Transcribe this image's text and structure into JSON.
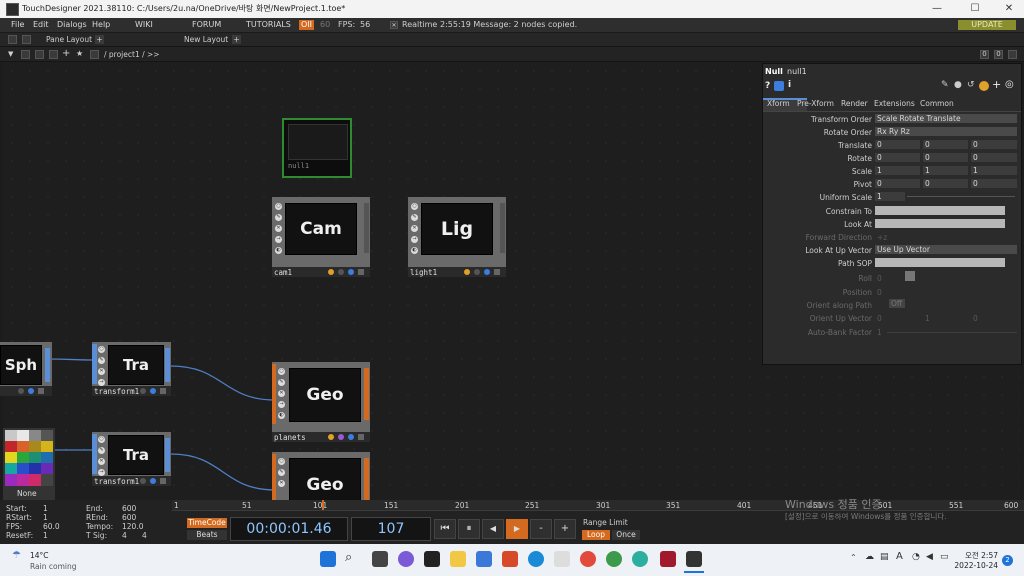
{
  "window": {
    "title": "TouchDesigner 2021.38110: C:/Users/2u.na/OneDrive/바탕 화면/NewProject.1.toe*"
  },
  "menu": {
    "items": [
      "File",
      "Edit",
      "Dialogs",
      "Help",
      "WIKI",
      "FORUM",
      "TUTORIALS"
    ],
    "oi": "OII",
    "fps_a": "60",
    "fps_label": "FPS:",
    "fps_value": "56",
    "realtime": "Realtime",
    "message": "2:55:19 Message: 2 nodes copied.",
    "update": "UPDATE"
  },
  "panebar": {
    "pane_layout": "Pane Layout",
    "new_layout": "New Layout",
    "plus": "+"
  },
  "pathbar": {
    "path": "/ project1 / >>",
    "right_a": "0",
    "right_b": "0"
  },
  "nodes": {
    "null_name": "null1",
    "cam_title": "Cam",
    "cam_name": "cam1",
    "light_title": "Lig",
    "light_name": "light1",
    "sph_title": "Sph",
    "tra1_title": "Tra",
    "tra1_name": "transform1",
    "geo1_title": "Geo",
    "geo1_name": "planets",
    "tra2_title": "Tra",
    "tra2_name": "transform1",
    "geo2_title": "Geo",
    "none_label": "None"
  },
  "params": {
    "type": "Null",
    "name": "null1",
    "tabs": [
      "Xform",
      "Pre-Xform",
      "Render",
      "Extensions",
      "Common"
    ],
    "rows": [
      {
        "label": "Transform Order",
        "value": "Scale Rotate Translate"
      },
      {
        "label": "Rotate Order",
        "value": "Rx Ry Rz"
      },
      {
        "label": "Translate",
        "v1": "0",
        "v2": "0",
        "v3": "0"
      },
      {
        "label": "Rotate",
        "v1": "0",
        "v2": "0",
        "v3": "0"
      },
      {
        "label": "Scale",
        "v1": "1",
        "v2": "1",
        "v3": "1"
      },
      {
        "label": "Pivot",
        "v1": "0",
        "v2": "0",
        "v3": "0"
      },
      {
        "label": "Uniform Scale",
        "value": "1"
      },
      {
        "label": "Constrain To"
      },
      {
        "label": "Look At"
      },
      {
        "label": "Forward Direction",
        "value": "+z"
      },
      {
        "label": "Look At Up Vector",
        "value": "Use Up Vector"
      },
      {
        "label": "Path SOP"
      },
      {
        "label": "Roll",
        "value": "0"
      },
      {
        "label": "Position",
        "value": "0"
      },
      {
        "label": "Orient along Path",
        "value": "Off"
      },
      {
        "label": "Orient Up Vector",
        "v1": "0",
        "v2": "1",
        "v3": "0"
      },
      {
        "label": "Auto-Bank Factor",
        "value": "1"
      }
    ]
  },
  "timeline": {
    "start_l": "Start:",
    "start_v": "1",
    "rstart_l": "RStart:",
    "rstart_v": "1",
    "fps_l": "FPS:",
    "fps_v": "60.0",
    "resetf_l": "ResetF:",
    "resetf_v": "1",
    "end_l": "End:",
    "end_v": "600",
    "rend_l": "REnd:",
    "rend_v": "600",
    "tempo_l": "Tempo:",
    "tempo_v": "120.0",
    "tsig_l": "T Sig:",
    "tsig_a": "4",
    "tsig_b": "4",
    "timecode": "TimeCode",
    "beats": "Beats",
    "time": "00:00:01.46",
    "frame": "107",
    "range_limit": "Range Limit",
    "loop": "Loop",
    "once": "Once",
    "ruler": [
      "1",
      "51",
      "101",
      "151",
      "201",
      "251",
      "301",
      "351",
      "401",
      "451",
      "501",
      "551",
      "600"
    ],
    "watermark_1": "Windows 정품 인증",
    "watermark_2": "[설정]으로 이동하여 Windows를 정품 인증합니다."
  },
  "taskbar": {
    "temp": "14°C",
    "weather": "Rain coming",
    "ime": "A",
    "clock_time": "오전 2:57",
    "clock_date": "2022-10-24",
    "badge": "2"
  },
  "colors": {
    "accent_orange": "#d46a1f",
    "node_green": "#2e8b2e",
    "param_blue": "#5a8ed6"
  }
}
